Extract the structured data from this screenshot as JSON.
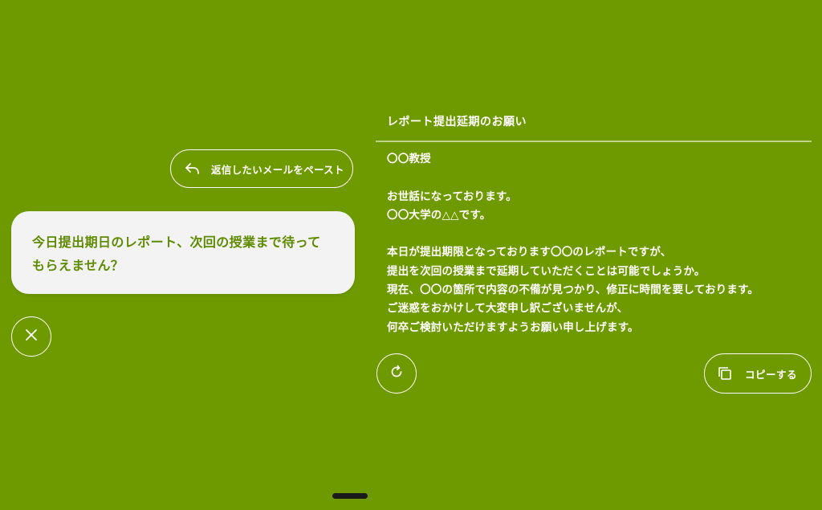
{
  "paste_button": {
    "label": "返信したいメールをペースト",
    "icon": "reply-icon"
  },
  "input": {
    "line1": "今日提出期日のレポート、次回の授業まで待って",
    "line2": "もらえません？"
  },
  "close_button": {
    "icon": "close-icon"
  },
  "email": {
    "subject": "レポート提出延期のお願い",
    "body_lines": [
      "〇〇教授",
      "",
      "お世話になっております。",
      "〇〇大学の△△です。",
      "",
      "本日が提出期限となっております〇〇のレポートですが、",
      "提出を次回の授業まで延期していただくことは可能でしょうか。",
      "現在、〇〇の箇所で内容の不備が見つかり、修正に時間を要しております。",
      "ご迷惑をおかけして大変申し訳ございませんが、",
      "何卒ご検討いただけますようお願い申し上げます。"
    ]
  },
  "regenerate_button": {
    "icon": "refresh-icon"
  },
  "copy_button": {
    "label": "コピーする",
    "icon": "copy-icon"
  },
  "colors": {
    "background": "#6e9a00",
    "bubble": "#f3f3f3",
    "bubble_text": "#5f8a00",
    "foreground": "#ffffff"
  }
}
